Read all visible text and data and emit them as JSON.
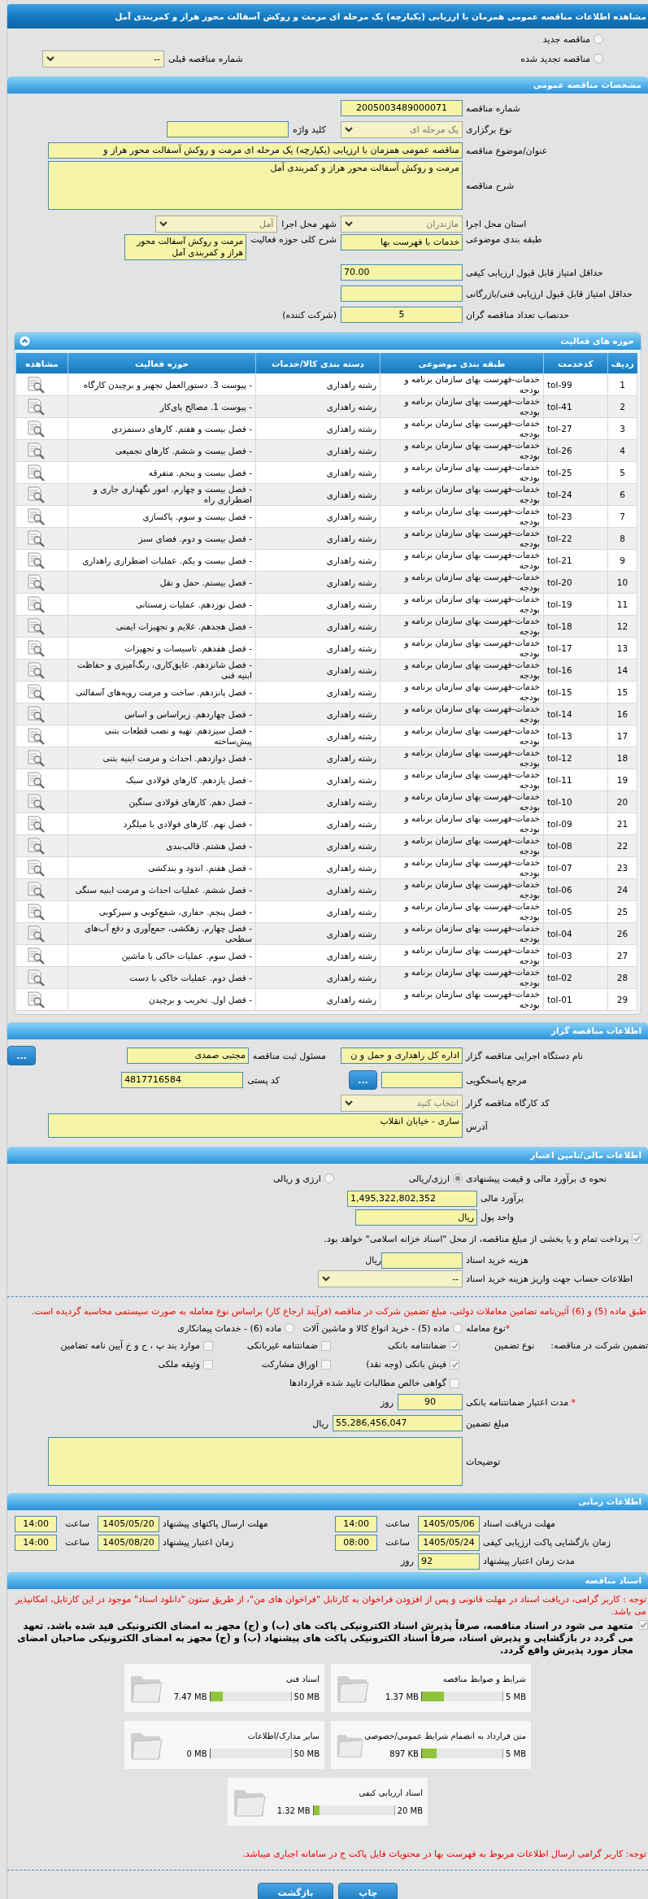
{
  "title": "مشاهده اطلاعات مناقصه عمومی همزمان با ارزیابی (یکپارچه) یک مرحله ای مرمت و روکش آسفالت محور هراز و کمربندی آمل",
  "tender_type": [
    {
      "label": "مناقصه جدید",
      "selected": false
    },
    {
      "label": "مناقصه تجدید شده",
      "selected": false
    }
  ],
  "previous_tender": {
    "label": "شماره مناقصه قبلی",
    "value": "--"
  },
  "general": {
    "header": "مشخصات مناقصه عمومی",
    "number": {
      "label": "شماره مناقصه",
      "value": "2005003489000071"
    },
    "holding_type": {
      "label": "نوع برگزاری",
      "value": "یک مرحله ای"
    },
    "keyword": {
      "label": "کلید واژه"
    },
    "subject": {
      "label": "عنوان/موضوع مناقصه",
      "value": "مناقصه عمومی همزمان با ارزیابی (یکپارچه) یک مرحله ای مرمت و روکش آسفالت محور هراز و"
    },
    "description": {
      "label": "شرح مناقصه",
      "value": "مرمت و روکش آسفالت محور هراز و کمربندی آمل"
    },
    "province": {
      "label": "استان محل اجرا",
      "value": "مازندران"
    },
    "city": {
      "label": "شهر محل اجرا",
      "value": "آمل"
    },
    "category": {
      "label": "طبقه بندی موضوعی",
      "value": "خدمات با فهرست بها"
    },
    "scope": {
      "label": "شرح کلی حوزه فعالیت",
      "value": "مرمت و روکش آسفالت محور هراز و کمربندی آمل"
    },
    "min_quality_score": {
      "label": "حداقل امتیاز قابل قبول ارزیابی کیفی",
      "value": "70.00"
    },
    "min_tech_score": {
      "label": "حداقل امتیاز قابل قبول ارزیابی فنی/بازرگانی"
    },
    "min_bidders": {
      "label": "حدنصاب تعداد مناقصه گران",
      "value": "5",
      "unit": "(شرکت کننده)"
    }
  },
  "activities": {
    "header": "حوزه های فعالیت",
    "columns": [
      "ردیف",
      "کدخدمت",
      "طبقه بندی موضوعی",
      "دسته بندی کالا/خدمات",
      "حوزه فعالیت",
      "مشاهده"
    ],
    "rows": [
      {
        "no": "1",
        "code": "tol-99",
        "category": "خدمات-فهرست بهای سازمان برنامه و بودجه",
        "group": "رشته راهداری",
        "scope": "- پیوست 3. دستورالعمل تجهیز و برچیدن کارگاه"
      },
      {
        "no": "2",
        "code": "tol-41",
        "category": "خدمات-فهرست بهای سازمان برنامه و بودجه",
        "group": "رشته راهداری",
        "scope": "- پیوست 1. مصالح پای‌کار"
      },
      {
        "no": "3",
        "code": "tol-27",
        "category": "خدمات-فهرست بهای سازمان برنامه و بودجه",
        "group": "رشته راهداری",
        "scope": "- فصل بیست و هفتم. کارهای دستمزدی"
      },
      {
        "no": "4",
        "code": "tol-26",
        "category": "خدمات-فهرست بهای سازمان برنامه و بودجه",
        "group": "رشته راهداری",
        "scope": "- فصل بیست و ششم. کارهای تجمیعی"
      },
      {
        "no": "5",
        "code": "tol-25",
        "category": "خدمات-فهرست بهای سازمان برنامه و بودجه",
        "group": "رشته راهداری",
        "scope": "- فصل بیست و پنجم. متفرقه"
      },
      {
        "no": "6",
        "code": "tol-24",
        "category": "خدمات-فهرست بهای سازمان برنامه و بودجه",
        "group": "رشته راهداری",
        "scope": "- فصل بیست و چهارم. امور نگهداری جاری و اضطراری راه"
      },
      {
        "no": "7",
        "code": "tol-23",
        "category": "خدمات-فهرست بهای سازمان برنامه و بودجه",
        "group": "رشته راهداری",
        "scope": "- فصل بیست و سوم. پاکسازی"
      },
      {
        "no": "8",
        "code": "tol-22",
        "category": "خدمات-فهرست بهای سازمان برنامه و بودجه",
        "group": "رشته راهداری",
        "scope": "- فصل بیست و دوم. فضای سبز"
      },
      {
        "no": "9",
        "code": "tol-21",
        "category": "خدمات-فهرست بهای سازمان برنامه و بودجه",
        "group": "رشته راهداری",
        "scope": "- فصل بیست و یکم. عملیات اضطراری راهداری"
      },
      {
        "no": "10",
        "code": "tol-20",
        "category": "خدمات-فهرست بهای سازمان برنامه و بودجه",
        "group": "رشته راهداری",
        "scope": "- فصل بیستم. حمل و نقل"
      },
      {
        "no": "11",
        "code": "tol-19",
        "category": "خدمات-فهرست بهای سازمان برنامه و بودجه",
        "group": "رشته راهداری",
        "scope": "- فصل نوزدهم. عملیات زمستانی"
      },
      {
        "no": "12",
        "code": "tol-18",
        "category": "خدمات-فهرست بهای سازمان برنامه و بودجه",
        "group": "رشته راهداری",
        "scope": "- فصل هجدهم. علایم و تجهیزات ایمنی"
      },
      {
        "no": "13",
        "code": "tol-17",
        "category": "خدمات-فهرست بهای سازمان برنامه و بودجه",
        "group": "رشته راهداری",
        "scope": "- فصل هفدهم. تاسیسات و تجهیزات"
      },
      {
        "no": "14",
        "code": "tol-16",
        "category": "خدمات-فهرست بهای سازمان برنامه و بودجه",
        "group": "رشته راهداری",
        "scope": "- فصل شانزدهم. عایق‌کاری، رنگ‌آمیزی و حفاظت ابنیه فنی"
      },
      {
        "no": "15",
        "code": "tol-15",
        "category": "خدمات-فهرست بهای سازمان برنامه و بودجه",
        "group": "رشته راهداری",
        "scope": "- فصل پانزدهم. ساخت و مرمت رویه‌های آسفالتی"
      },
      {
        "no": "16",
        "code": "tol-14",
        "category": "خدمات-فهرست بهای سازمان برنامه و بودجه",
        "group": "رشته راهداری",
        "scope": "- فصل چهاردهم. زیراساس و اساس"
      },
      {
        "no": "17",
        "code": "tol-13",
        "category": "خدمات-فهرست بهای سازمان برنامه و بودجه",
        "group": "رشته راهداری",
        "scope": "- فصل سیزدهم. تهیه و نصب قطعات بتنی پیش‌ساخته"
      },
      {
        "no": "18",
        "code": "tol-12",
        "category": "خدمات-فهرست بهای سازمان برنامه و بودجه",
        "group": "رشته راهداری",
        "scope": "- فصل دوازدهم. احداث و مرمت ابنیه بتنی"
      },
      {
        "no": "19",
        "code": "tol-11",
        "category": "خدمات-فهرست بهای سازمان برنامه و بودجه",
        "group": "رشته راهداری",
        "scope": "- فصل یازدهم. کارهای فولادی سبک"
      },
      {
        "no": "20",
        "code": "tol-10",
        "category": "خدمات-فهرست بهای سازمان برنامه و بودجه",
        "group": "رشته راهداری",
        "scope": "- فصل دهم. کارهای فولادی سنگین"
      },
      {
        "no": "21",
        "code": "tol-09",
        "category": "خدمات-فهرست بهای سازمان برنامه و بودجه",
        "group": "رشته راهداری",
        "scope": "- فصل نهم. کارهای فولادی با میلگرد"
      },
      {
        "no": "22",
        "code": "tol-08",
        "category": "خدمات-فهرست بهای سازمان برنامه و بودجه",
        "group": "رشته راهداری",
        "scope": "- فصل هشتم. قالب‌بندی"
      },
      {
        "no": "23",
        "code": "tol-07",
        "category": "خدمات-فهرست بهای سازمان برنامه و بودجه",
        "group": "رشته راهداری",
        "scope": "- فصل هفتم. اندود و بندکشی"
      },
      {
        "no": "24",
        "code": "tol-06",
        "category": "خدمات-فهرست بهای سازمان برنامه و بودجه",
        "group": "رشته راهداری",
        "scope": "- فصل ششم.  عملیات احداث و مرمت ابنیه سنگی"
      },
      {
        "no": "25",
        "code": "tol-05",
        "category": "خدمات-فهرست بهای سازمان برنامه و بودجه",
        "group": "رشته راهداری",
        "scope": "- فصل پنجم. حفاری، شمع‌کوبی و سپرکوبی"
      },
      {
        "no": "26",
        "code": "tol-04",
        "category": "خدمات-فهرست بهای سازمان برنامه و بودجه",
        "group": "رشته راهداری",
        "scope": "- فصل چهارم. زهکشی، جمع‌آوری و دفع آب‌های سطحی"
      },
      {
        "no": "27",
        "code": "tol-03",
        "category": "خدمات-فهرست بهای سازمان برنامه و بودجه",
        "group": "رشته راهداری",
        "scope": "- فصل سوم. عملیات خاکی با ماشین"
      },
      {
        "no": "28",
        "code": "tol-02",
        "category": "خدمات-فهرست بهای سازمان برنامه و بودجه",
        "group": "رشته راهداری",
        "scope": "- فصل دوم. عملیات خاکی با دست"
      },
      {
        "no": "29",
        "code": "tol-01",
        "category": "خدمات-فهرست بهای سازمان برنامه و بودجه",
        "group": "رشته راهداری",
        "scope": "- فصل اول. تخریب و برچیدن"
      }
    ]
  },
  "organizer": {
    "header": "اطلاعات مناقصه گزار",
    "org_name": {
      "label": "نام دستگاه اجرایی مناقصه گزار",
      "value": "اداره کل راهداری و حمل و ن"
    },
    "registrar": {
      "label": "مسئول ثبت مناقصه",
      "value": "مجتبی صمدی",
      "button": "..."
    },
    "reference": {
      "label": "مرجع پاسخگویی",
      "button": "..."
    },
    "postal_code": {
      "label": "کد پستی",
      "value": "4817716584"
    },
    "workshop_code": {
      "label": "کد کارگاه مناقصه گزار",
      "value": "انتخاب کنید"
    },
    "address": {
      "label": "آدرس",
      "value": "ساری - خیابان  انقلاب"
    }
  },
  "finance": {
    "header": "اطلاعات مالی/تامین اعتبار",
    "estimate_method": {
      "label": "نحوه ی برآورد مالی و قیمت پیشنهادی",
      "options": [
        {
          "label": "ارزی/ریالی",
          "selected": true
        },
        {
          "label": "ارزی و ریالی",
          "selected": false
        }
      ]
    },
    "estimate": {
      "label": "برآورد مالی",
      "value": "1,495,322,802,352"
    },
    "currency": {
      "label": "واحد پول",
      "value": "ریال"
    },
    "treasury": {
      "label": "پرداخت تمام و یا بخشی از مبلغ مناقصه، از محل \"اسناد خزانه اسلامی\" خواهد بود.",
      "checked": true
    },
    "doc_cost": {
      "label": "هزینه خرید اسناد",
      "unit": "ریال"
    },
    "account": {
      "label": "اطلاعات حساب جهت واریز هزینه خرید اسناد",
      "value": "--"
    },
    "notice": "طبق ماده (5) و (6) آئین‌نامه تضامین معاملات دولتی، مبلغ تضمین شرکت در مناقصه (فرآیند ارجاع کار) براساس نوع معامله به صورت سیستمی محاسبه گردیده است.",
    "deal_type": {
      "required_mark": "*",
      "label": "نوع معامله",
      "options": [
        {
          "label": "ماده (5) - خرید انواع کالا و ماشین آلات",
          "selected": false
        },
        {
          "label": "ماده (6) - خدمات پیمانکاری",
          "selected": false
        }
      ]
    },
    "guarantee": {
      "label": "تضمین شرکت در مناقصه:",
      "type_label": "نوع تضمین",
      "options": [
        {
          "label": "ضمانتنامه بانکی",
          "checked": true
        },
        {
          "label": "ضمانتنامه غیربانکی",
          "checked": false
        },
        {
          "label": "موارد بند پ ، ح و خ آیین نامه تضامین",
          "checked": false
        },
        {
          "label": "فیش بانکی (وجه نقد)",
          "checked": true
        },
        {
          "label": "اوراق مشارکت",
          "checked": false
        },
        {
          "label": "وثیقه ملکی",
          "checked": false
        },
        {
          "label": "گواهی خالص مطالبات تایید شده قراردادها",
          "checked": false
        }
      ]
    },
    "guarantee_validity": {
      "required_mark": "*",
      "label": "مدت اعتبار ضمانتنامه بانکی",
      "value": "90",
      "unit": "روز"
    },
    "amount": {
      "label": "مبلغ تضمین",
      "value": "55,286,456,047",
      "unit": "ریال"
    },
    "notes": {
      "label": "توضیحات"
    }
  },
  "timing": {
    "header": "اطلاعات زمانی",
    "fields": [
      {
        "label": "مهلت دریافت اسناد",
        "date": "1405/05/06",
        "time_label": "ساعت",
        "time": "14:00"
      },
      {
        "label": "مهلت ارسال پاکتهای پیشنهاد",
        "date": "1405/05/20",
        "time_label": "ساعت",
        "time": "14:00"
      },
      {
        "label": "زمان بازگشایی پاکت ارزیابی کیفی",
        "date": "1405/05/24",
        "time_label": "ساعت",
        "time": "08:00"
      },
      {
        "label": "زمان اعتبار پیشنهاد",
        "date": "1405/08/20",
        "time_label": "ساعت",
        "time": "14:00"
      }
    ],
    "validity_days": {
      "label": "مدت زمان اعتبار پیشنهاد",
      "value": "92",
      "unit": "روز"
    }
  },
  "documents": {
    "header": "اسناد مناقصه",
    "notice": "توجه : کاربر گرامی، دریافت اسناد در مهلت قانونی و پس از افزودن فراخوان به کارتابل \"فراخوان های من\"، از طریق ستون \"دانلود اسناد\" موجود در این کارتابل، امکانپذیر می باشد.",
    "commitment": {
      "text": "متعهد می شود در اسناد مناقصه، صرفاً پذیرش اسناد الکترونیکی پاکت های (ب) و (ج) مجهز به امضای الکترونیکی قید شده باشد. تعهد می گردد در بازگشایی و پذیرش اسناد، صرفاً اسناد الکترونیکی پاکت های پیشنهاد (ب) و (ج) مجهز به امضای الکترونیکی صاحبان امضای مجاز مورد پذیرش واقع گردد.",
      "checked": true
    },
    "files": [
      {
        "name": "شرایط و ضوابط مناقصه",
        "limit": "5 MB",
        "size": "1.37 MB",
        "level": 0.27
      },
      {
        "name": "اسناد فنی",
        "limit": "50 MB",
        "size": "7.47 MB",
        "level": 0.15
      },
      {
        "name": "متن قرارداد به انضمام شرایط عمومی/خصوصی",
        "limit": "5 MB",
        "size": "897 KB",
        "level": 0.18
      },
      {
        "name": "سایر مدارک/اطلاعات",
        "limit": "50 MB",
        "size": "0 MB",
        "level": 0
      },
      {
        "name": "اسناد ارزیابی کیفی",
        "limit": "20 MB",
        "size": "1.32 MB",
        "level": 0.07
      }
    ],
    "footer_notice": "توجه: کاربر گرامی ارسال اطلاعات مربوط به فهرست بها در محتویات فایل پاکت ج در سامانه اجباری میباشد."
  },
  "buttons": [
    {
      "label": "چاپ"
    },
    {
      "label": "بازگشت"
    }
  ]
}
